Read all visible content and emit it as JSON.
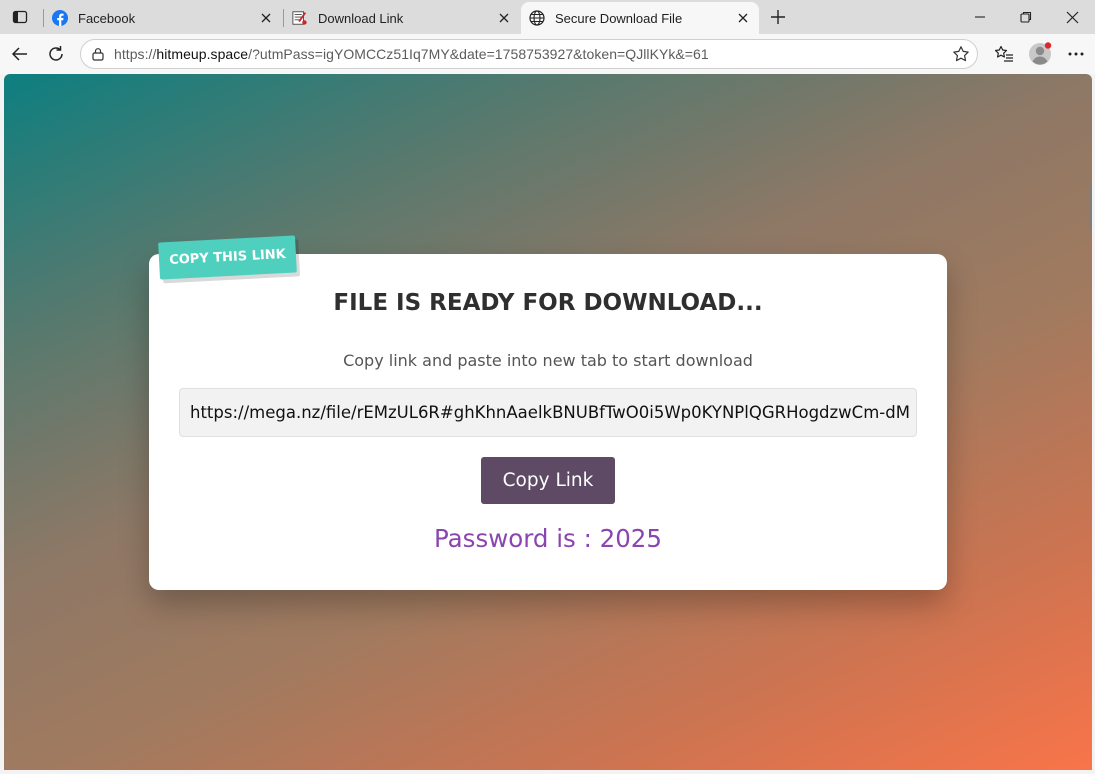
{
  "browser": {
    "tabs": [
      {
        "title": "Facebook",
        "favicon": "facebook-icon",
        "active": false
      },
      {
        "title": "Download Link",
        "favicon": "document-favicon-icon",
        "active": false
      },
      {
        "title": "Secure Download File",
        "favicon": "globe-icon",
        "active": true
      }
    ],
    "url": {
      "prefix": "https://",
      "host": "hitmeup.space",
      "rest": "/?utmPass=igYOMCCz51Iq7MY&date=1758753927&token=QJllKYk&=61"
    }
  },
  "page": {
    "ribbon_label": "COPY THIS LINK",
    "title": "FILE IS READY FOR DOWNLOAD...",
    "subtitle": "Copy link and paste into new tab to start download",
    "link_value": "https://mega.nz/file/rEMzUL6R#ghKhnAaelkBNUBfTwO0i5Wp0KYNPlQGRHogdzwCm-dM",
    "copy_button_label": "Copy Link",
    "password_text": "Password is : 2025"
  },
  "colors": {
    "ribbon": "#4fd0be",
    "button": "#5e4a65",
    "password": "#8a45b0",
    "gradient_start": "#0d7f80",
    "gradient_end": "#f97449"
  }
}
